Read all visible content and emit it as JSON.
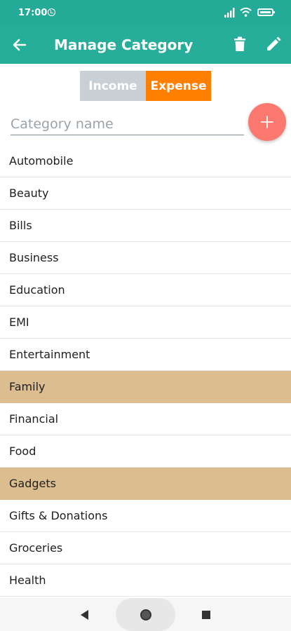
{
  "status_bar": {
    "time": "17:00",
    "icons": [
      "alarm-icon",
      "signal-icon",
      "wifi-icon",
      "battery-icon"
    ]
  },
  "app_bar": {
    "title": "Manage Category",
    "icons": [
      "back-arrow-icon",
      "trash-icon",
      "pencil-icon"
    ],
    "background_color": "#26ae9b"
  },
  "type_toggle": {
    "options": [
      {
        "label": "Income",
        "selected": false,
        "color": "#c8cfd5"
      },
      {
        "label": "Expense",
        "selected": true,
        "color": "#ff7f00"
      }
    ]
  },
  "category_input": {
    "value": "",
    "placeholder": "Category name",
    "add_icon": "plus-icon",
    "add_button_color": "#fb796f"
  },
  "categories": [
    {
      "label": "Automobile",
      "selected": false
    },
    {
      "label": "Beauty",
      "selected": false
    },
    {
      "label": "Bills",
      "selected": false
    },
    {
      "label": "Business",
      "selected": false
    },
    {
      "label": "Education",
      "selected": false
    },
    {
      "label": "EMI",
      "selected": false
    },
    {
      "label": "Entertainment",
      "selected": false
    },
    {
      "label": "Family",
      "selected": true
    },
    {
      "label": "Financial",
      "selected": false
    },
    {
      "label": "Food",
      "selected": false
    },
    {
      "label": "Gadgets",
      "selected": true
    },
    {
      "label": "Gifts & Donations",
      "selected": false
    },
    {
      "label": "Groceries",
      "selected": false
    },
    {
      "label": "Health",
      "selected": false
    }
  ],
  "selected_row_color": "#dbbd90",
  "navigation_bar": {
    "icons": [
      "nav-back-icon",
      "nav-home-icon",
      "nav-recent-apps-icon"
    ]
  }
}
